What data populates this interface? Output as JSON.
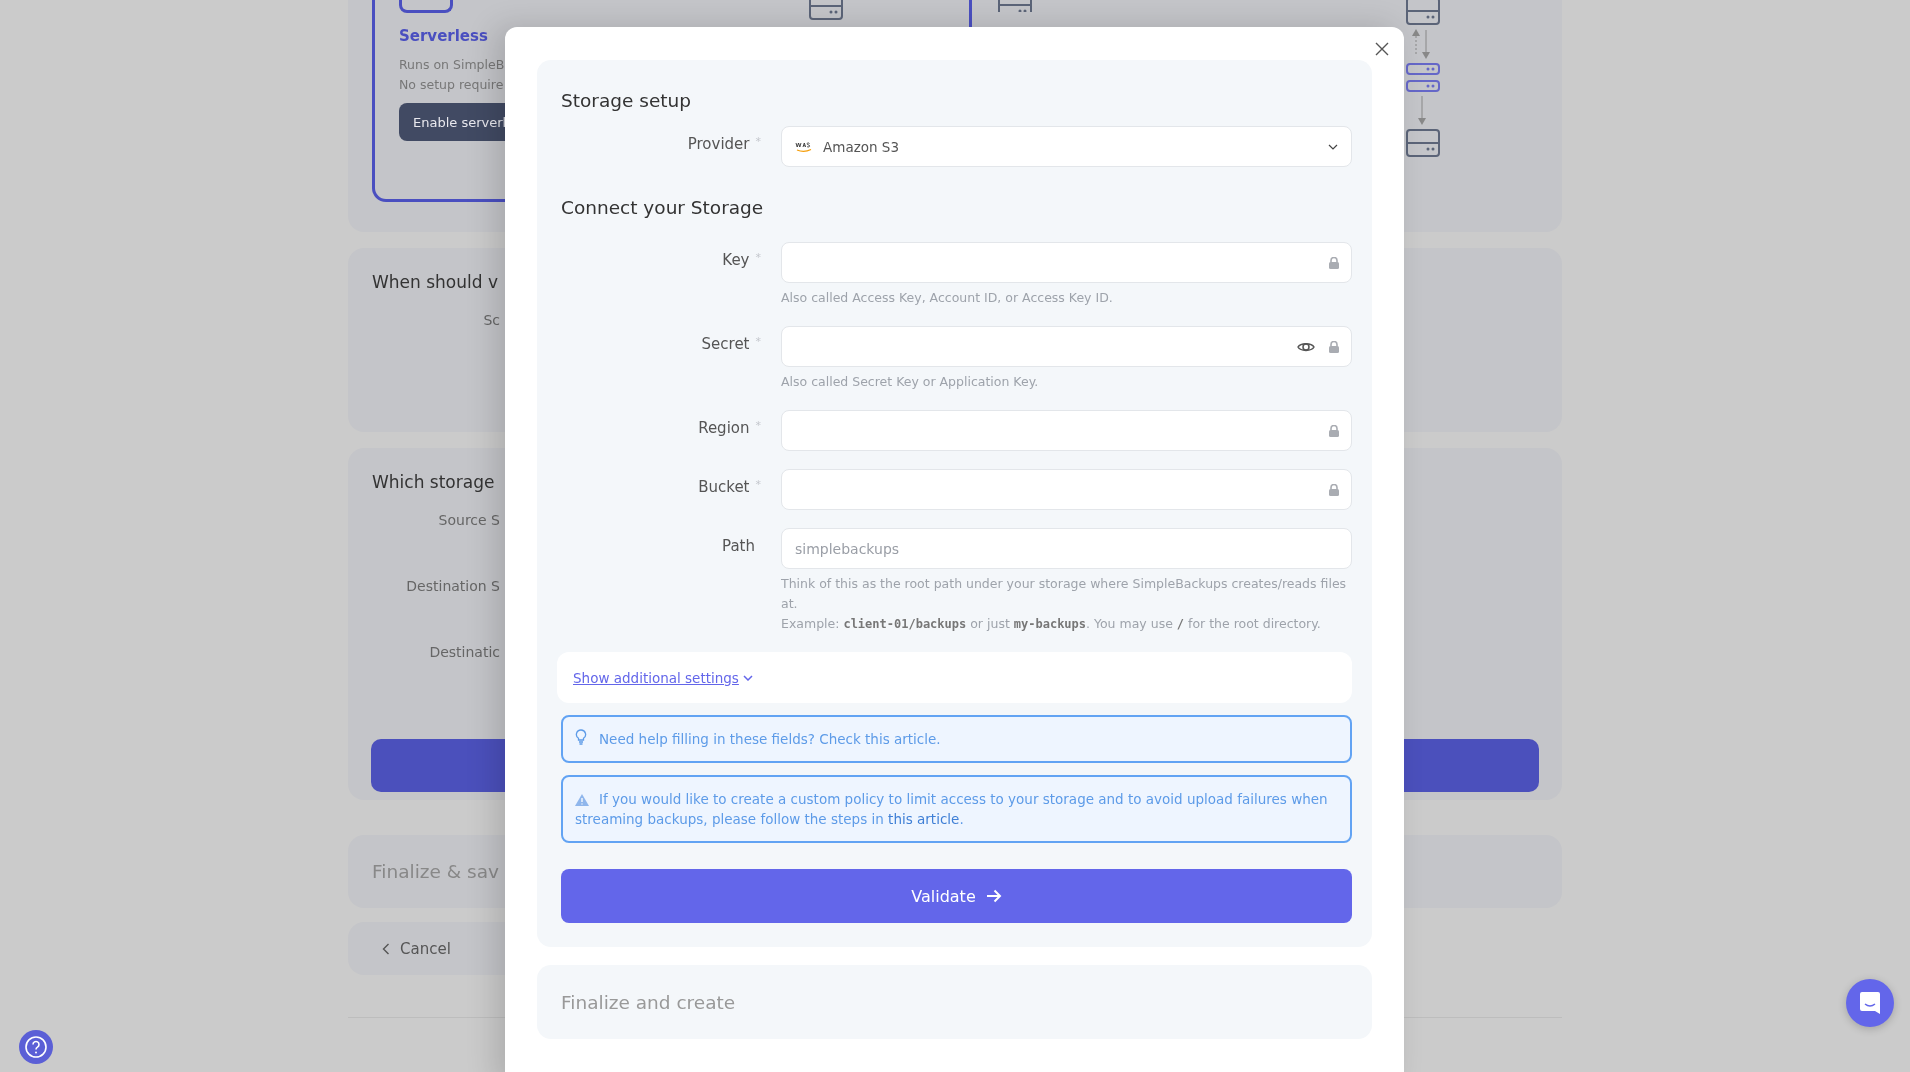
{
  "background": {
    "plan_card": {
      "title": "Serverless",
      "lines": [
        "Runs on SimpleB",
        "No setup require"
      ],
      "button": "Enable serverl",
      "selected": true
    },
    "sections": [
      {
        "title": "When should v",
        "fields": [
          "Sc"
        ]
      },
      {
        "title": "Which storage",
        "fields": [
          "Source S",
          "Destination S",
          "Destinatic"
        ]
      }
    ],
    "finalize_title": "Finalize & sav",
    "cancel": "Cancel"
  },
  "modal": {
    "title": "Storage setup",
    "provider": {
      "label": "Provider",
      "required_mark": "*",
      "value": "Amazon S3"
    },
    "connect_title": "Connect your Storage",
    "fields": [
      {
        "label": "Key",
        "required_mark": "*",
        "locked": true,
        "reveal": false,
        "hint": "Also called Access Key, Account ID, or Access Key ID."
      },
      {
        "label": "Secret",
        "required_mark": "*",
        "locked": true,
        "reveal": true,
        "hint": "Also called Secret Key or Application Key."
      },
      {
        "label": "Region",
        "required_mark": "*",
        "locked": true,
        "reveal": false
      },
      {
        "label": "Bucket",
        "required_mark": "*",
        "locked": true,
        "reveal": false
      },
      {
        "label": "Path",
        "locked": false,
        "reveal": false,
        "placeholder": "simplebackups",
        "hint": "Think of this as the root path under your storage where SimpleBackups creates/reads files at.",
        "example": [
          {
            "kind": "text",
            "text": "Example: "
          },
          {
            "kind": "code",
            "text": "client-01/backups"
          },
          {
            "kind": "text",
            "text": " or just "
          },
          {
            "kind": "code",
            "text": "my-backups"
          },
          {
            "kind": "text",
            "text": ". You may use "
          },
          {
            "kind": "code",
            "text": "/"
          },
          {
            "kind": "text",
            "text": " for the root directory."
          }
        ]
      }
    ],
    "additional_settings": "Show additional settings",
    "alerts": [
      {
        "kind": "tip",
        "text": "Need help filling in these fields? Check this article."
      },
      {
        "kind": "warning",
        "text": "If you would like to create a custom policy to limit access to your storage and to avoid upload failures when streaming backups, please follow the steps in ",
        "link": "this article",
        "text_end": "."
      }
    ],
    "validate": "Validate",
    "next_section": "Finalize and create"
  }
}
